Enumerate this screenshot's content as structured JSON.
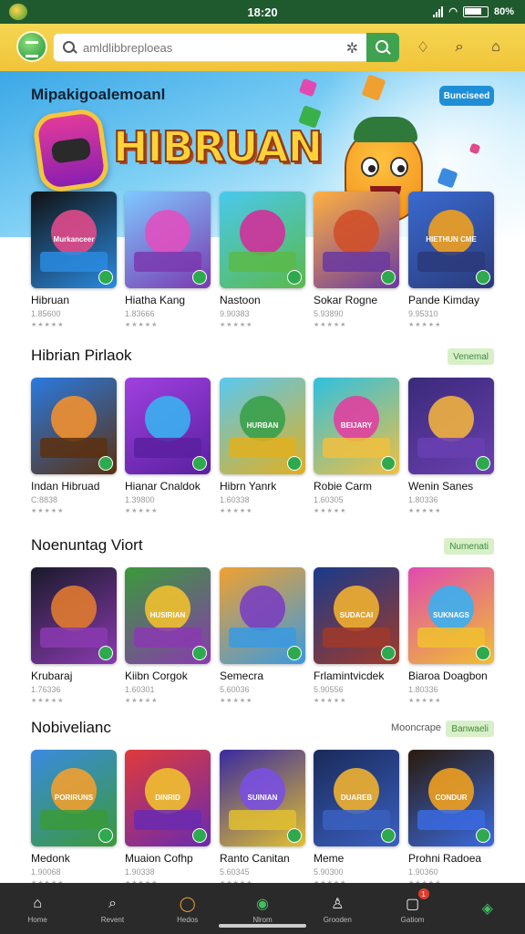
{
  "status_bar": {
    "time": "18:20",
    "battery": "80%"
  },
  "top_bar": {
    "search_placeholder": "amldlibbreploeas"
  },
  "hero": {
    "subtitle": "Mipakigoalemoanl",
    "title": "HIBRUAN",
    "cta": "Bunciseed"
  },
  "sections": [
    {
      "title": "",
      "see_all": "",
      "cards": [
        {
          "name": "Hibruan",
          "meta": "1.85600",
          "thumb_text": "Murkanceer",
          "colors": [
            "#111111",
            "#e04a8a",
            "#2a8ae0"
          ]
        },
        {
          "name": "Hiatha Kang",
          "meta": "1.83666",
          "thumb_text": "",
          "colors": [
            "#7fc8ff",
            "#e050c0",
            "#7a3ab0"
          ]
        },
        {
          "name": "Nastoon",
          "meta": "9.90383",
          "thumb_text": "",
          "colors": [
            "#4ac8f0",
            "#d0309a",
            "#5aba4a"
          ]
        },
        {
          "name": "Sokar Rogne",
          "meta": "5.93890",
          "thumb_text": "",
          "colors": [
            "#ffb040",
            "#d0502a",
            "#6a3aa0"
          ]
        },
        {
          "name": "Pande Kimday",
          "meta": "9.95310",
          "thumb_text": "HIETHUN CME",
          "colors": [
            "#3a6ad0",
            "#f0a020",
            "#2a3a7a"
          ]
        }
      ]
    },
    {
      "title": "Hibrian Pirlaok",
      "see_all": "Venemal",
      "cards": [
        {
          "name": "Indan Hibruad",
          "meta": "C:8838",
          "thumb_text": "",
          "colors": [
            "#2a7ae0",
            "#f09030",
            "#5a3010"
          ]
        },
        {
          "name": "Hianar Cnaldok",
          "meta": "1.39800",
          "thumb_text": "",
          "colors": [
            "#a040e0",
            "#3ab0f0",
            "#5a20a0"
          ]
        },
        {
          "name": "Hibrn Yanrk",
          "meta": "1.60338",
          "thumb_text": "HURBAN",
          "colors": [
            "#5ac8f0",
            "#3aa04a",
            "#e0b020"
          ]
        },
        {
          "name": "Robie Carm",
          "meta": "1.60305",
          "thumb_text": "BEIJARY",
          "colors": [
            "#30c0e0",
            "#e040a0",
            "#f0c040"
          ]
        },
        {
          "name": "Wenin Sanes",
          "meta": "1.80336",
          "thumb_text": "",
          "colors": [
            "#3a2a7a",
            "#f0b040",
            "#6a40b0"
          ]
        }
      ]
    },
    {
      "title": "Noenuntag Viort",
      "see_all": "Numenati",
      "cards": [
        {
          "name": "Krubaraj",
          "meta": "1.76336",
          "thumb_text": "",
          "colors": [
            "#1a1a2a",
            "#e07a30",
            "#8a3ab0"
          ]
        },
        {
          "name": "Kiibn Corgok",
          "meta": "1.60301",
          "thumb_text": "HUSIRIAN",
          "colors": [
            "#3a9a3a",
            "#f0c030",
            "#8a3ab0"
          ]
        },
        {
          "name": "Semecra",
          "meta": "5.60036",
          "thumb_text": "",
          "colors": [
            "#f0a030",
            "#7a40c0",
            "#3a9ae0"
          ]
        },
        {
          "name": "Frlamintvicdek",
          "meta": "5.90556",
          "thumb_text": "SUDACAI",
          "colors": [
            "#1a3a8a",
            "#f0b030",
            "#a03a2a"
          ]
        },
        {
          "name": "Biaroa Doagbon",
          "meta": "1.80336",
          "thumb_text": "SUKNAGS",
          "colors": [
            "#e04ab0",
            "#3ab0f0",
            "#f0c030"
          ]
        }
      ]
    },
    {
      "title": "Nobivelianc",
      "see_all": "Banwaeli",
      "see_all_text": "Mooncrape",
      "cards": [
        {
          "name": "Medonk",
          "meta": "1.90068",
          "thumb_text": "PORIRUNS",
          "colors": [
            "#3a8ae0",
            "#f0a030",
            "#3a9a3a"
          ]
        },
        {
          "name": "Muaion Cofhp",
          "meta": "1.90338",
          "thumb_text": "DINRID",
          "colors": [
            "#e03a3a",
            "#f0c030",
            "#6a2ab0"
          ]
        },
        {
          "name": "Ranto Canitan",
          "meta": "5.60345",
          "thumb_text": "SUINIAN",
          "colors": [
            "#3a2aa0",
            "#7a50e0",
            "#e0c030"
          ]
        },
        {
          "name": "Meme",
          "meta": "5.90300",
          "thumb_text": "DUAREB",
          "colors": [
            "#1a2a5a",
            "#f0b030",
            "#3a60c0"
          ]
        },
        {
          "name": "Prohni Radoea",
          "meta": "1.90360",
          "thumb_text": "CONDUR",
          "colors": [
            "#2a1a0a",
            "#f0a020",
            "#3a6ae0"
          ]
        }
      ]
    }
  ],
  "stars": "★★★★★",
  "bottom_nav": [
    {
      "label": "Home",
      "icon": "home-icon"
    },
    {
      "label": "Revent",
      "icon": "search-icon"
    },
    {
      "label": "Hedos",
      "icon": "game-icon"
    },
    {
      "label": "Nlrom",
      "icon": "chart-icon"
    },
    {
      "label": "Grooden",
      "icon": "user-icon"
    },
    {
      "label": "Gatiom",
      "icon": "chat-icon",
      "badge": "1"
    },
    {
      "label": "",
      "icon": "brand-icon"
    }
  ]
}
